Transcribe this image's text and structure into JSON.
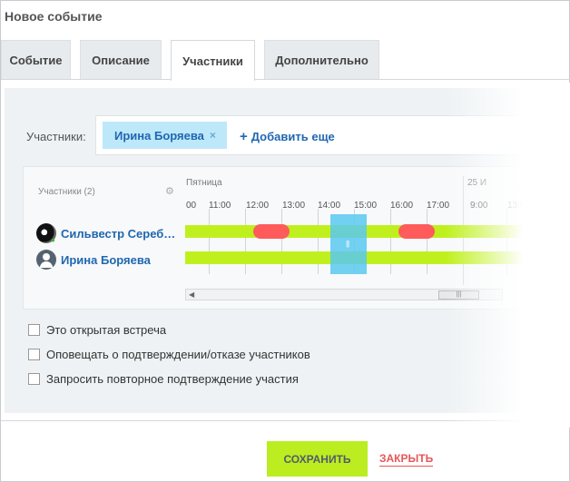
{
  "window": {
    "title": "Новое событие"
  },
  "tabs": [
    {
      "label": "Событие"
    },
    {
      "label": "Описание"
    },
    {
      "label": "Участники"
    },
    {
      "label": "Дополнительно"
    }
  ],
  "attendees_field": {
    "label": "Участники:",
    "tags": [
      {
        "name": "Ирина Боряева",
        "remove_icon": "×"
      }
    ],
    "add_more": {
      "icon": "+",
      "label": "Добавить еще"
    }
  },
  "planner": {
    "header_label": "Участники (2)",
    "settings_icon": "⚙",
    "day_labels": [
      "Пятница",
      "25 И"
    ],
    "hours": [
      "00",
      "11:00",
      "12:00",
      "13:00",
      "14:00",
      "15:00",
      "16:00",
      "17:00",
      "9:00",
      "13:00",
      "15:"
    ],
    "people": [
      {
        "name": "Сильвестр Сереб…",
        "avatar": "photo"
      },
      {
        "name": "Ирина Боряева",
        "avatar": "default"
      }
    ],
    "selection_grip": "|||",
    "scroll_thumb": "|||",
    "scroll_left_icon": "◀"
  },
  "options": [
    {
      "label": "Это открытая встреча",
      "checked": false
    },
    {
      "label": "Оповещать о подтверждении/отказе участников",
      "checked": false
    },
    {
      "label": "Запросить повторное подтверждение участия",
      "checked": false
    }
  ],
  "footer": {
    "save_label": "СОХРАНИТЬ",
    "close_label": "ЗАКРЫТЬ"
  },
  "colors": {
    "free": "#bff01e",
    "busy": "#ff5b5b",
    "selection": "#5bc9f0",
    "accent_link": "#2067b0"
  }
}
